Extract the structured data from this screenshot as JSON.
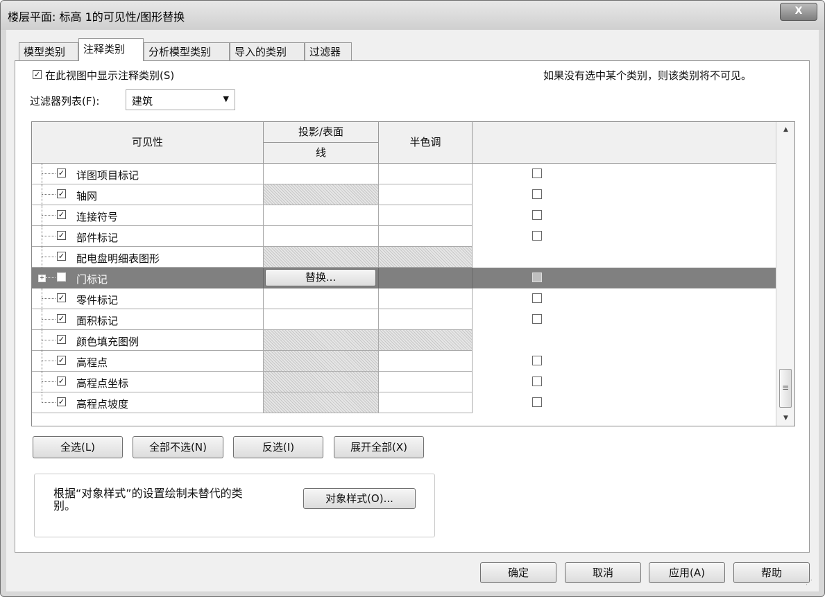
{
  "window": {
    "title": "楼层平面: 标高 1的可见性/图形替换",
    "close_label": "X"
  },
  "tabs": [
    {
      "label": "模型类别"
    },
    {
      "label": "注释类别"
    },
    {
      "label": "分析模型类别"
    },
    {
      "label": "导入的类别"
    },
    {
      "label": "过滤器"
    }
  ],
  "show_annotations": {
    "label": "在此视图中显示注释类别(S)",
    "checked": true
  },
  "hint_text": "如果没有选中某个类别，则该类别将不可见。",
  "filter": {
    "label": "过滤器列表(F):",
    "value": "建筑"
  },
  "table": {
    "headers": {
      "visibility": "可见性",
      "projection": "投影/表面",
      "line": "线",
      "halftone": "半色调"
    },
    "override_button": "替换...",
    "rows": [
      {
        "name": "详图项目标记",
        "checked": true
      },
      {
        "name": "轴网",
        "checked": true
      },
      {
        "name": "连接符号",
        "checked": true
      },
      {
        "name": "部件标记",
        "checked": true
      },
      {
        "name": "配电盘明细表图形",
        "checked": true
      },
      {
        "name": "门标记",
        "checked": false
      },
      {
        "name": "零件标记",
        "checked": true
      },
      {
        "name": "面积标记",
        "checked": true
      },
      {
        "name": "颜色填充图例",
        "checked": true
      },
      {
        "name": "高程点",
        "checked": true
      },
      {
        "name": "高程点坐标",
        "checked": true
      },
      {
        "name": "高程点坡度",
        "checked": true
      }
    ]
  },
  "buttons": {
    "select_all": "全选(L)",
    "select_none": "全部不选(N)",
    "invert": "反选(I)",
    "expand_all": "展开全部(X)",
    "object_styles": "对象样式(O)...",
    "ok": "确定",
    "cancel": "取消",
    "apply": "应用(A)",
    "help": "帮助"
  },
  "object_styles_note": {
    "line1": "根据“对象样式”的设置绘制未替代的类",
    "line2": "别。"
  }
}
